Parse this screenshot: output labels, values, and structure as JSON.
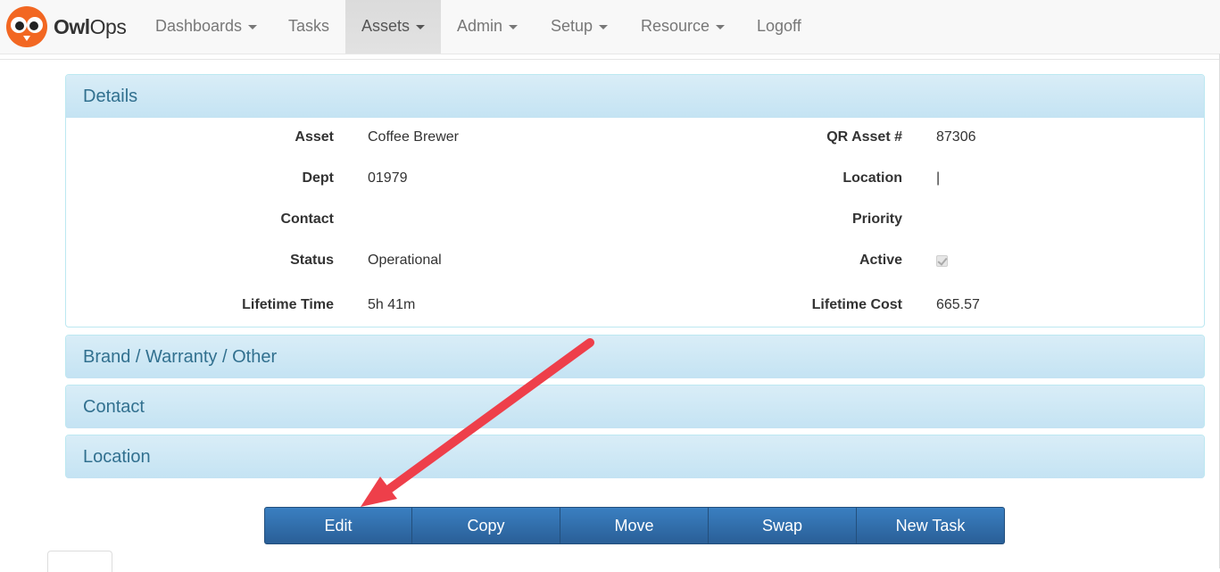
{
  "brand": {
    "name_bold": "Owl",
    "name_regular": "Ops"
  },
  "nav": {
    "items": [
      {
        "label": "Dashboards",
        "dropdown": true
      },
      {
        "label": "Tasks",
        "dropdown": false
      },
      {
        "label": "Assets",
        "dropdown": true,
        "active": true
      },
      {
        "label": "Admin",
        "dropdown": true
      },
      {
        "label": "Setup",
        "dropdown": true
      },
      {
        "label": "Resource",
        "dropdown": true
      },
      {
        "label": "Logoff",
        "dropdown": false
      }
    ]
  },
  "details": {
    "heading": "Details",
    "left": [
      {
        "label": "Asset",
        "value": "Coffee Brewer"
      },
      {
        "label": "Dept",
        "value": "01979"
      },
      {
        "label": "Contact",
        "value": ""
      },
      {
        "label": "Status",
        "value": "Operational"
      },
      {
        "label": "Lifetime Time",
        "value": "5h 41m"
      }
    ],
    "right": [
      {
        "label": "QR Asset #",
        "value": "87306"
      },
      {
        "label": "Location",
        "value": "|"
      },
      {
        "label": "Priority",
        "value": ""
      },
      {
        "label": "Active",
        "value": "",
        "checkbox_checked": true
      },
      {
        "label": "Lifetime Cost",
        "value": "665.57"
      }
    ]
  },
  "panels": [
    {
      "heading": "Brand / Warranty / Other"
    },
    {
      "heading": "Contact"
    },
    {
      "heading": "Location"
    }
  ],
  "actions": {
    "edit": "Edit",
    "copy": "Copy",
    "move": "Move",
    "swap": "Swap",
    "new_task": "New Task"
  },
  "tabs": [],
  "colors": {
    "panel_text": "#31708f",
    "panel_bg": "#d9edf7",
    "button_bg": "#2f6ca8",
    "annotation_arrow": "#ee3f4a",
    "logo_orange": "#f26722"
  }
}
